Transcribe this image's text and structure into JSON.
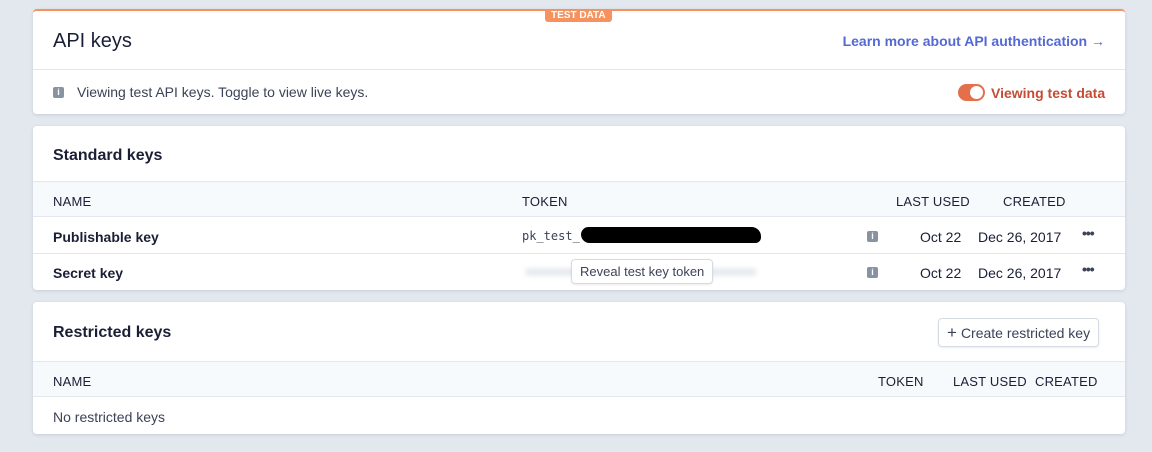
{
  "header": {
    "badge": "TEST DATA",
    "title": "API keys",
    "learn_more": "Learn more about API authentication",
    "learn_more_arrow": "→",
    "info_text": "Viewing test API keys. Toggle to view live keys.",
    "toggle_label": "Viewing test data",
    "toggle_on": true
  },
  "standard": {
    "title": "Standard keys",
    "columns": [
      "NAME",
      "TOKEN",
      "LAST USED",
      "CREATED"
    ],
    "rows": [
      {
        "name": "Publishable key",
        "token_prefix": "pk_test_",
        "last_used": "Oct 22",
        "created": "Dec 26, 2017"
      },
      {
        "name": "Secret key",
        "token_tooltip": "Reveal test key token",
        "last_used": "Oct 22",
        "created": "Dec 26, 2017"
      }
    ]
  },
  "restricted": {
    "title": "Restricted keys",
    "create_button": "Create restricted key",
    "columns": [
      "NAME",
      "TOKEN",
      "LAST USED",
      "CREATED"
    ],
    "empty": "No restricted keys"
  },
  "colors": {
    "accent": "#5469d4",
    "test": "#e56f4a",
    "badge": "#f5925e"
  }
}
